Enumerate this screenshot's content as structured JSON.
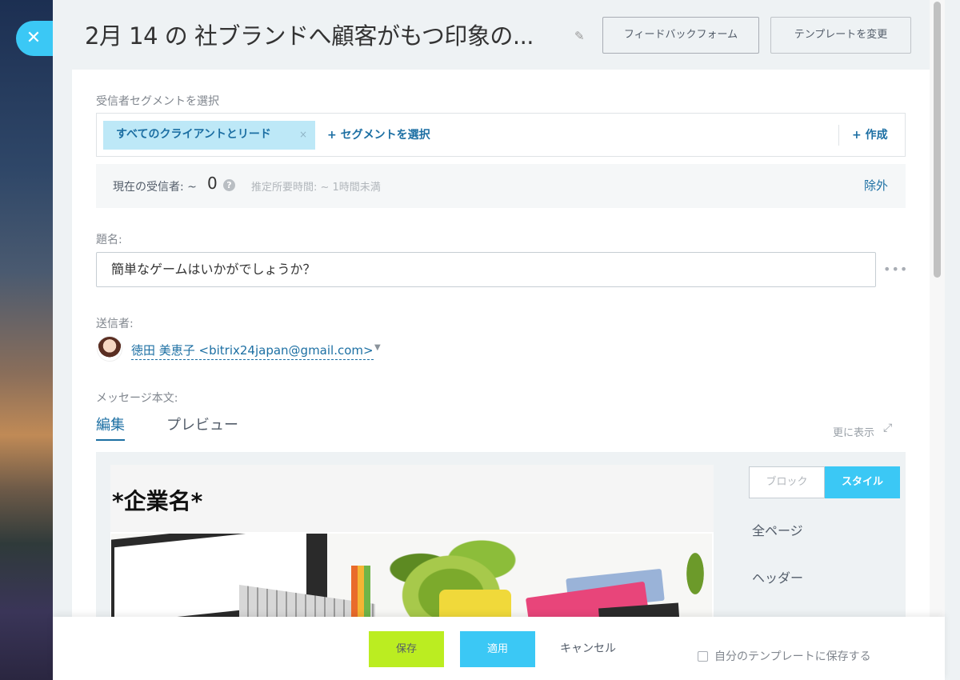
{
  "header": {
    "title": "2月 14 の 社ブランドへ顧客がもつ印象の...",
    "feedback_button": "フィードバックフォーム",
    "template_button": "テンプレートを変更"
  },
  "segments": {
    "label": "受信者セグメントを選択",
    "selected": "すべてのクライアントとリード",
    "remove_symbol": "×",
    "add_label": "+ セグメントを選択",
    "create_label": "+ 作成"
  },
  "recipients": {
    "label": "現在の受信者: ~",
    "count": "0",
    "help_symbol": "?",
    "estimated_time": "推定所要時間: ~ 1時間未満",
    "exclude": "除外"
  },
  "subject": {
    "label": "題名:",
    "value": "簡単なゲームはいかがでしょうか？"
  },
  "sender": {
    "label": "送信者:",
    "value": "徳田 美恵子 <bitrix24japan@gmail.com>"
  },
  "message": {
    "label": "メッセージ本文:",
    "tabs": [
      "編集",
      "プレビュー"
    ],
    "show_more": "更に表示",
    "email_company_name": "*企業名*"
  },
  "side_panel": {
    "tabs": [
      "ブロック",
      "スタイル"
    ],
    "items": [
      "全ページ",
      "ヘッダー"
    ]
  },
  "footer": {
    "save": "保存",
    "apply": "適用",
    "cancel": "キャンセル",
    "save_template": "自分のテンプレートに保存する"
  },
  "colors": {
    "accent_blue": "#3bc8f5",
    "link_blue": "#1c6fa3",
    "save_green": "#bbed21"
  }
}
